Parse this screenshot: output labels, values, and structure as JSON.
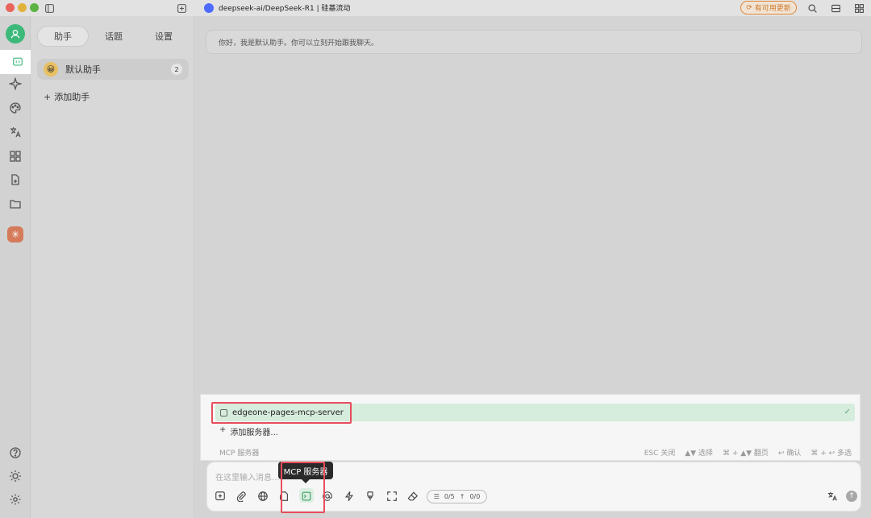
{
  "window": {
    "topic_title": "deepseek-ai/DeepSeek-R1 | 硅基流动",
    "update_label": "有可用更新"
  },
  "panel": {
    "tabs": [
      {
        "label": "助手",
        "active": true
      },
      {
        "label": "话题",
        "active": false
      },
      {
        "label": "设置",
        "active": false
      }
    ],
    "assistant": {
      "name": "默认助手",
      "count": "2",
      "emoji": "😀"
    },
    "add_assistant": "添加助手"
  },
  "chat": {
    "welcome": "你好，我是默认助手。你可以立刻开始跟我聊天。"
  },
  "mcp": {
    "server_name": "edgeone-pages-mcp-server",
    "add_server": "添加服务器...",
    "section_label": "MCP 服务器",
    "hints": [
      "ESC 关闭",
      "▲▼ 选择",
      "⌘ + ▲▼ 翻页",
      "↩ 确认",
      "⌘ + ↩ 多选"
    ],
    "tooltip": "MCP 服务器"
  },
  "input": {
    "placeholder": "在这里输入消息...",
    "context_count": "0/5",
    "token_count": "0/0"
  },
  "colors": {
    "accent_green": "#3cb97a",
    "highlight_red": "#e84d5b",
    "update_orange": "#e08a3a"
  }
}
